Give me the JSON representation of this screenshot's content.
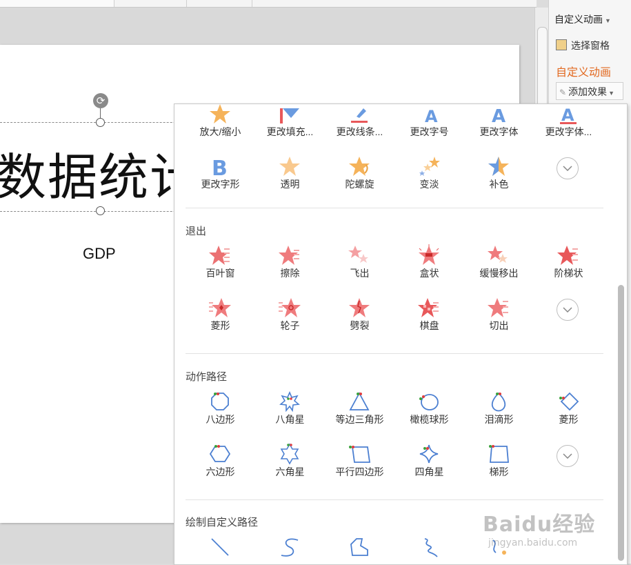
{
  "slide": {
    "title": "数据统计",
    "subtitle": "GDP"
  },
  "task_pane": {
    "header": "自定义动画",
    "select_pane": "选择窗格",
    "section_title": "自定义动画",
    "add_effect": "添加效果"
  },
  "gallery": {
    "emphasis_row1": [
      "放大/缩小",
      "更改填充...",
      "更改线条...",
      "更改字号",
      "更改字体",
      "更改字体..."
    ],
    "emphasis_row2": [
      "更改字形",
      "透明",
      "陀螺旋",
      "变淡",
      "补色"
    ],
    "exit": {
      "title": "退出",
      "row1": [
        "百叶窗",
        "擦除",
        "飞出",
        "盒状",
        "缓慢移出",
        "阶梯状"
      ],
      "row2": [
        "菱形",
        "轮子",
        "劈裂",
        "棋盘",
        "切出"
      ]
    },
    "paths": {
      "title": "动作路径",
      "row1": [
        "八边形",
        "八角星",
        "等边三角形",
        "橄榄球形",
        "泪滴形",
        "菱形"
      ],
      "row2": [
        "六边形",
        "六角星",
        "平行四边形",
        "四角星",
        "梯形"
      ]
    },
    "custom_paths": {
      "title": "绘制自定义路径"
    }
  },
  "watermark": {
    "brand": "Baidu经验",
    "url": "jingyan.baidu.com"
  },
  "colors": {
    "accent": "#e2681f",
    "star": "#f5b35a",
    "exit_red": "#e8585a",
    "path_blue": "#4b7fd1"
  }
}
